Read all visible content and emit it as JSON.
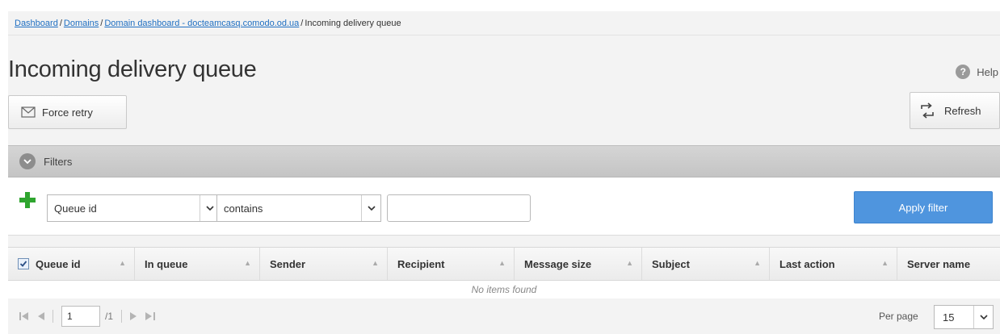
{
  "breadcrumb": {
    "items": [
      "Dashboard",
      "Domains",
      "Domain dashboard - docteamcasq.comodo.od.ua"
    ],
    "current": "Incoming delivery queue",
    "separator": "/"
  },
  "page": {
    "title": "Incoming delivery queue",
    "help_label": "Help",
    "help_icon_glyph": "?"
  },
  "toolbar": {
    "force_retry_label": "Force retry",
    "refresh_label": "Refresh"
  },
  "filters": {
    "label": "Filters",
    "field_value": "Queue id",
    "operator_value": "contains",
    "text_value": "",
    "apply_label": "Apply filter"
  },
  "table": {
    "columns": [
      "Queue id",
      "In queue",
      "Sender",
      "Recipient",
      "Message size",
      "Subject",
      "Last action",
      "Server name"
    ],
    "select_all_checked": true,
    "empty_message": "No items found"
  },
  "pagination": {
    "current_page": "1",
    "total_pages": "/1",
    "per_page_label": "Per page",
    "per_page_value": "15"
  },
  "colors": {
    "accent": "#4f95de",
    "link": "#1f6fc2",
    "add_icon": "#2fa52f"
  },
  "icons": {
    "force_retry": "envelope-icon",
    "refresh": "refresh-icon",
    "help": "help-icon",
    "filters": "chevron-circle-icon",
    "add_filter": "plus-icon"
  }
}
